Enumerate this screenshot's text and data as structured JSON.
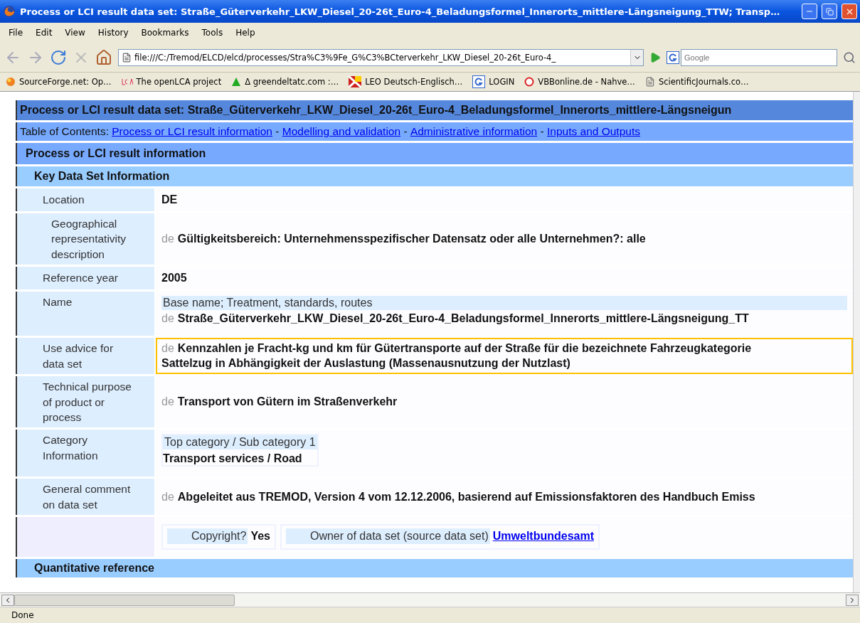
{
  "window": {
    "title": "Process or LCI result data set: Straße_Güterverkehr_LKW_Diesel_20-26t_Euro-4_Beladungsformel_Innerorts_mittlere-Längsneigung_TTW; Transp…"
  },
  "menu": [
    "File",
    "Edit",
    "View",
    "History",
    "Bookmarks",
    "Tools",
    "Help"
  ],
  "address": {
    "value": "file:///C:/Tremod/ELCD/elcd/processes/Stra%C3%9Fe_G%C3%BCterverkehr_LKW_Diesel_20-26t_Euro-4_"
  },
  "search": {
    "placeholder": "Google"
  },
  "bookmarks": [
    {
      "label": "SourceForge.net: Op…",
      "kind": "orb"
    },
    {
      "label": "The openLCA project",
      "kind": "lca"
    },
    {
      "label": "Δ greendeltatc.com :…",
      "kind": "triangle"
    },
    {
      "label": "LEO Deutsch-Englisch…",
      "kind": "flag"
    },
    {
      "label": "LOGIN",
      "kind": "g"
    },
    {
      "label": "VBBonline.de - Nahve…",
      "kind": "ring"
    },
    {
      "label": "ScientificJournals.co…",
      "kind": "page"
    }
  ],
  "page": {
    "title": "Process or LCI result data set: Straße_Güterverkehr_LKW_Diesel_20-26t_Euro-4_Beladungsformel_Innerorts_mittlere-Längsneigun",
    "toc": {
      "label": "Table of Contents:",
      "separator": "-",
      "links": [
        "Process or LCI result information",
        "Modelling and validation",
        "Administrative information",
        "Inputs and Outputs"
      ]
    },
    "section": "Process or LCI result information",
    "subsection": "Key Data Set Information",
    "rows": [
      {
        "kind": "plain",
        "label": "Location",
        "value": "DE",
        "highlighted": false
      },
      {
        "kind": "lang",
        "label": "Geographical representativity description",
        "indent": true,
        "lang": "de",
        "lines": [
          "Gültigkeitsbereich: Unternehmensspezifischer Datensatz oder alle Unternehmen?: alle"
        ],
        "highlighted": false
      },
      {
        "kind": "plain",
        "label": "Reference year",
        "value": "2005",
        "highlighted": false
      },
      {
        "kind": "name",
        "label": "Name",
        "caption": "Base name; Treatment, standards, routes",
        "lang": "de",
        "value": "Straße_Güterverkehr_LKW_Diesel_20-26t_Euro-4_Beladungsformel_Innerorts_mittlere-Längsneigung_TT",
        "highlighted": false
      },
      {
        "kind": "lang",
        "label": "Use advice for data set",
        "lang": "de",
        "lines": [
          "Kennzahlen je Fracht-kg und km für Gütertransporte auf der Straße für die bezeichnete Fahrzeugkategorie",
          "Sattelzug in Abhängigkeit der Auslastung (Massenausnutzung der Nutzlast)"
        ],
        "highlighted": true
      },
      {
        "kind": "lang",
        "label": "Technical purpose of product or process",
        "lang": "de",
        "lines": [
          "Transport von Gütern im Straßenverkehr"
        ],
        "highlighted": false
      },
      {
        "kind": "category",
        "label": "Category Information",
        "caption": "Top category / Sub category 1",
        "value": "Transport services / Road",
        "highlighted": false
      },
      {
        "kind": "lang",
        "label": "General comment on data set",
        "lang": "de",
        "lines": [
          "Abgeleitet aus TREMOD, Version 4 vom 12.12.2006, basierend auf Emissionsfaktoren des Handbuch Emiss"
        ],
        "highlighted": false
      },
      {
        "kind": "sharing",
        "copyright_label": "Copyright?",
        "copyright_value": "Yes",
        "owner_label": "Owner of data set (source data set)",
        "owner_link": "Umweltbundesamt",
        "highlighted": false
      }
    ],
    "next_section": "Quantitative reference"
  },
  "status_bar": "Done"
}
